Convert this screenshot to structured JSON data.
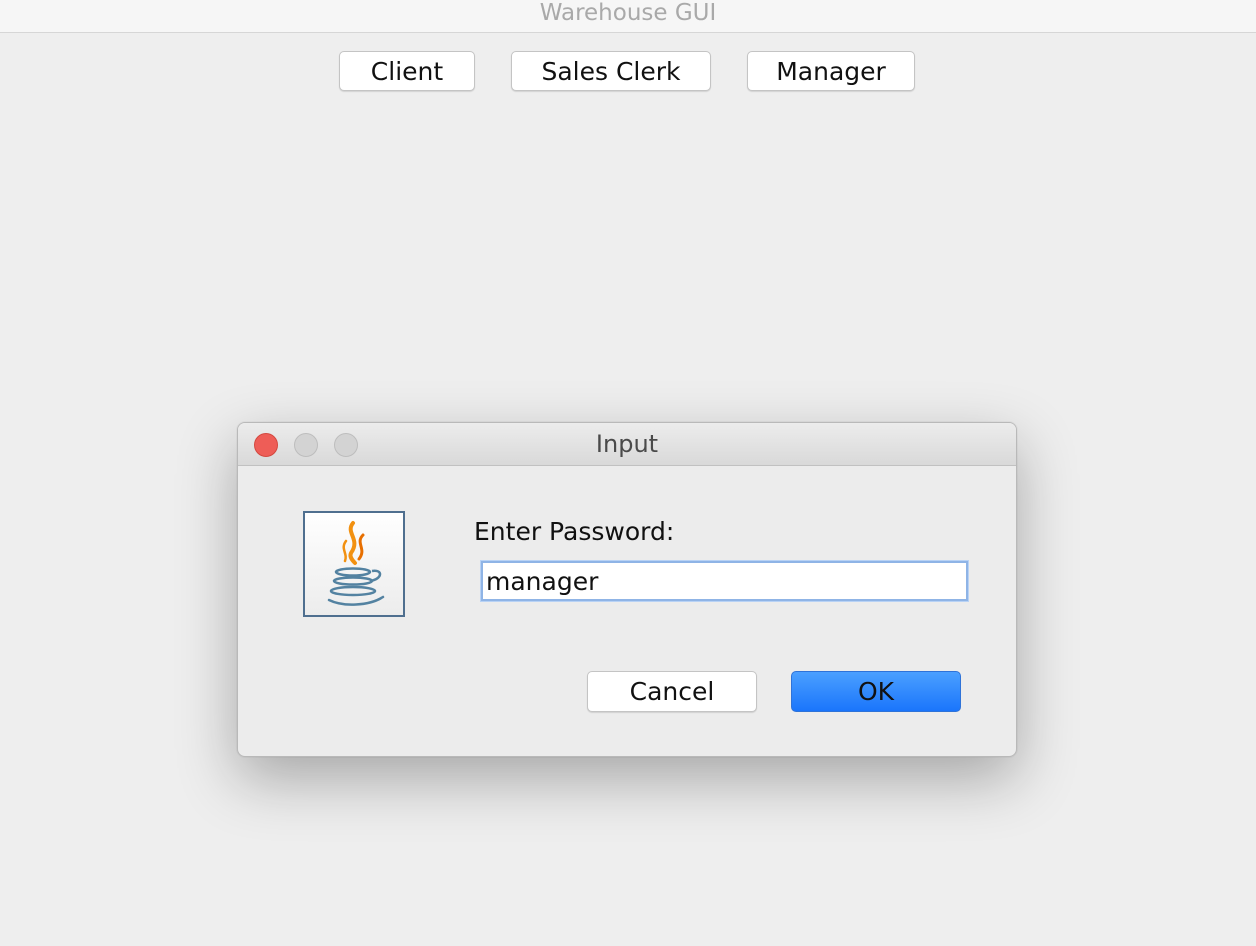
{
  "window": {
    "title": "Warehouse GUI"
  },
  "toolbar": {
    "buttons": [
      {
        "label": "Client"
      },
      {
        "label": "Sales Clerk"
      },
      {
        "label": "Manager"
      }
    ]
  },
  "dialog": {
    "title": "Input",
    "icon": "java-logo-icon",
    "prompt": "Enter Password:",
    "password_value": "manager",
    "cancel_label": "Cancel",
    "ok_label": "OK",
    "colors": {
      "ok_accent": "#1a75fb",
      "close_button": "#ee5d57",
      "field_focus": "#8fb4e6"
    }
  }
}
